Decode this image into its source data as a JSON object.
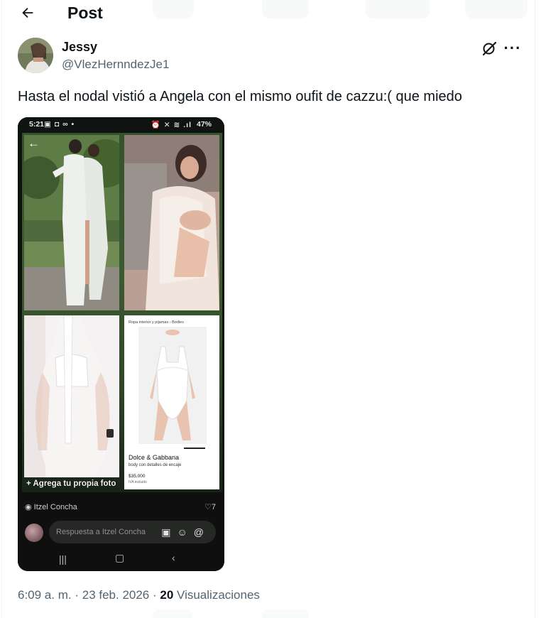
{
  "header": {
    "title": "Post"
  },
  "author": {
    "name": "Jessy",
    "handle": "@VlezHernndezJe1"
  },
  "tweet": {
    "text": "Hasta el nodal vistió a Angela con el mismo oufit de cazzu:( que miedo"
  },
  "media_screenshot": {
    "status_time": "5:21",
    "status_battery": "47%",
    "product": {
      "breadcrumb": "Ropa interior y pijamas  ›  Bodies",
      "brand": "Dolce & Gabbana",
      "description": "body con detalles de encaje",
      "price": "$35,000",
      "tax_note": "IVA incluido"
    },
    "add_photo_label": "+ Agrega tu propia foto",
    "user_label": "Itzel Concha",
    "like_count": "♡7",
    "reply_placeholder": "Respuesta a Itzel Concha"
  },
  "meta": {
    "time": "6:09 a. m.",
    "date": "23 feb. 2026",
    "views_count": "20",
    "views_label": "Visualizaciones"
  },
  "icons": {
    "back": "arrow-left-icon",
    "grok": "grok-icon",
    "more": "more-icon"
  },
  "colors": {
    "text_primary": "#0f1419",
    "text_secondary": "#536471",
    "border": "#eff3f4"
  }
}
